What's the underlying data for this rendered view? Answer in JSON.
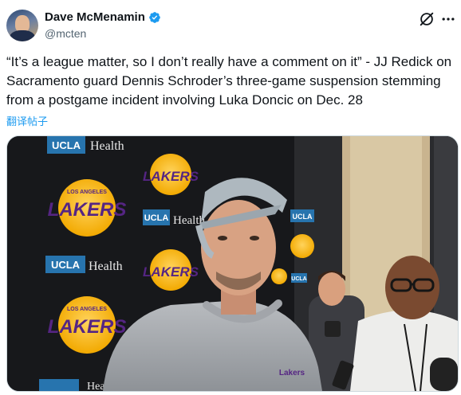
{
  "author": {
    "name": "Dave McMenamin",
    "handle": "@mcten",
    "verified": true
  },
  "tweet": {
    "text": "“It’s a league matter, so I don’t really have a comment on it” - JJ Redick on Sacramento guard Dennis Schroder’s three-game suspension stemming from a postgame incident involving Luka Doncic on Dec. 28",
    "translate_label": "翻译帖子"
  },
  "icons": {
    "verified": "verified-badge-icon",
    "grok": "grok-icon",
    "more": "more-options-icon"
  },
  "media": {
    "backdrop_texts": {
      "ucla": "UCLA",
      "health": "Health",
      "lakers": "LAKERS",
      "los_angeles": "LOS ANGELES",
      "shirt": "Lakers"
    }
  },
  "colors": {
    "verified_blue": "#1d9bf0",
    "link_blue": "#1d9bf0",
    "lakers_purple": "#552583",
    "lakers_gold": "#fdb927",
    "ucla_blue": "#2774ae"
  }
}
